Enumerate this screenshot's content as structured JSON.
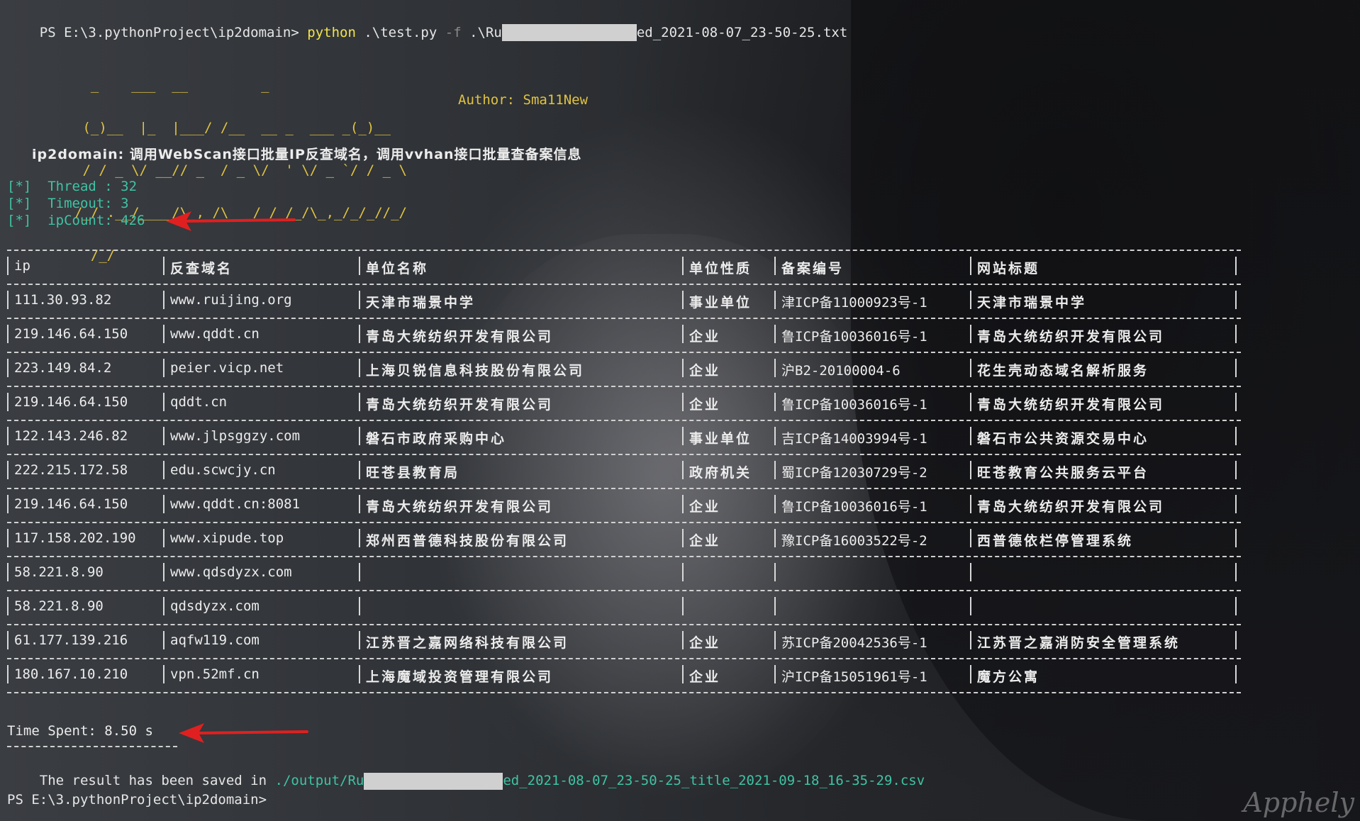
{
  "terminal": {
    "prompt_cmd": {
      "prompt": "PS E:\\3.pythonProject\\ip2domain> ",
      "python": "python",
      "script": " .\\test.py ",
      "flag": "-f",
      "arg_prefix": " .\\Ru",
      "arg_suffix": "ed_2021-08-07_23-50-25.txt"
    },
    "banner_lines": [
      "  _    ___  __         _",
      " (_)__  |_  |___/ /__  __ _  ___ _(_)__",
      " / / _ \\/ __// _  / _ \\/  ' \\/ _ `/ / _ \\",
      "/_/ .__/____/\\_,_/\\___/_/_/_/\\_,_/_/_//_/",
      "  /_/"
    ],
    "author": "Author: Sma11New",
    "description": "ip2domain: 调用WebScan接口批量IP反查域名，调用vvhan接口批量查备案信息",
    "info_lines": [
      "[*]  Thread : 32",
      "[*]  Timeout: 3",
      "[*]  ipCount: 426"
    ],
    "table": {
      "headers": [
        "ip",
        "反查域名",
        "单位名称",
        "单位性质",
        "备案编号",
        "网站标题"
      ],
      "rows": [
        [
          "111.30.93.82",
          "www.ruijing.org",
          "天津市瑞景中学",
          "事业单位",
          "津ICP备11000923号-1",
          "天津市瑞景中学"
        ],
        [
          "219.146.64.150",
          "www.qddt.cn",
          "青岛大统纺织开发有限公司",
          "企业",
          "鲁ICP备10036016号-1",
          "青岛大统纺织开发有限公司"
        ],
        [
          "223.149.84.2",
          "peier.vicp.net",
          "上海贝锐信息科技股份有限公司",
          "企业",
          "沪B2-20100004-6",
          "花生壳动态域名解析服务"
        ],
        [
          "219.146.64.150",
          "qddt.cn",
          "青岛大统纺织开发有限公司",
          "企业",
          "鲁ICP备10036016号-1",
          "青岛大统纺织开发有限公司"
        ],
        [
          "122.143.246.82",
          "www.jlpsggzy.com",
          "磐石市政府采购中心",
          "事业单位",
          "吉ICP备14003994号-1",
          "磐石市公共资源交易中心"
        ],
        [
          "222.215.172.58",
          "edu.scwcjy.cn",
          "旺苍县教育局",
          "政府机关",
          "蜀ICP备12030729号-2",
          "旺苍教育公共服务云平台"
        ],
        [
          "219.146.64.150",
          "www.qddt.cn:8081",
          "青岛大统纺织开发有限公司",
          "企业",
          "鲁ICP备10036016号-1",
          "青岛大统纺织开发有限公司"
        ],
        [
          "117.158.202.190",
          "www.xipude.top",
          "郑州西普德科技股份有限公司",
          "企业",
          "豫ICP备16003522号-2",
          "西普德依栏停管理系统"
        ],
        [
          "58.221.8.90",
          "www.qdsdyzx.com",
          "",
          "",
          "",
          ""
        ],
        [
          "58.221.8.90",
          "qdsdyzx.com",
          "",
          "",
          "",
          ""
        ],
        [
          "61.177.139.216",
          "aqfw119.com",
          "江苏晋之嘉网络科技有限公司",
          "企业",
          "苏ICP备20042536号-1",
          "江苏晋之嘉消防安全管理系统"
        ],
        [
          "180.167.10.210",
          "vpn.52mf.cn",
          "上海魔域投资管理有限公司",
          "企业",
          "沪ICP备15051961号-1",
          "魔方公寓"
        ]
      ]
    },
    "time_spent": "Time Spent: 8.50 s",
    "saved_prefix": "The result has been saved in ",
    "saved_path_prefix": "./output/Ru",
    "saved_path_suffix": "ed_2021-08-07_23-50-25_title_2021-09-18_16-35-29.csv",
    "final_prompt": "PS E:\\3.pythonProject\\ip2domain>",
    "watermark": "Apphely"
  },
  "colors": {
    "accent_green": "#3fc3a4",
    "banner_yellow": "#e1c341",
    "arrow_red": "#e02020"
  }
}
